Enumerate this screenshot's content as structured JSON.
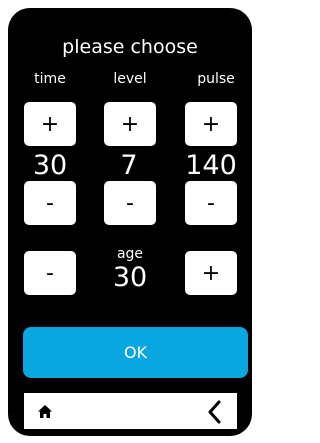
{
  "screen": {
    "title": "please choose"
  },
  "columns": {
    "time": {
      "label": "time",
      "value": "30"
    },
    "level": {
      "label": "level",
      "value": "7"
    },
    "pulse": {
      "label": "pulse",
      "value": "140"
    }
  },
  "controls": {
    "plus_label": "+",
    "minus_label": "-"
  },
  "age": {
    "label": "age",
    "value": "30"
  },
  "ok_button": {
    "label": "OK"
  },
  "nav": {
    "home_icon": "home-icon",
    "back_icon": "chevron-left-icon"
  },
  "colors": {
    "background": "#000000",
    "accent": "#0aa6e0",
    "button": "#ffffff"
  }
}
